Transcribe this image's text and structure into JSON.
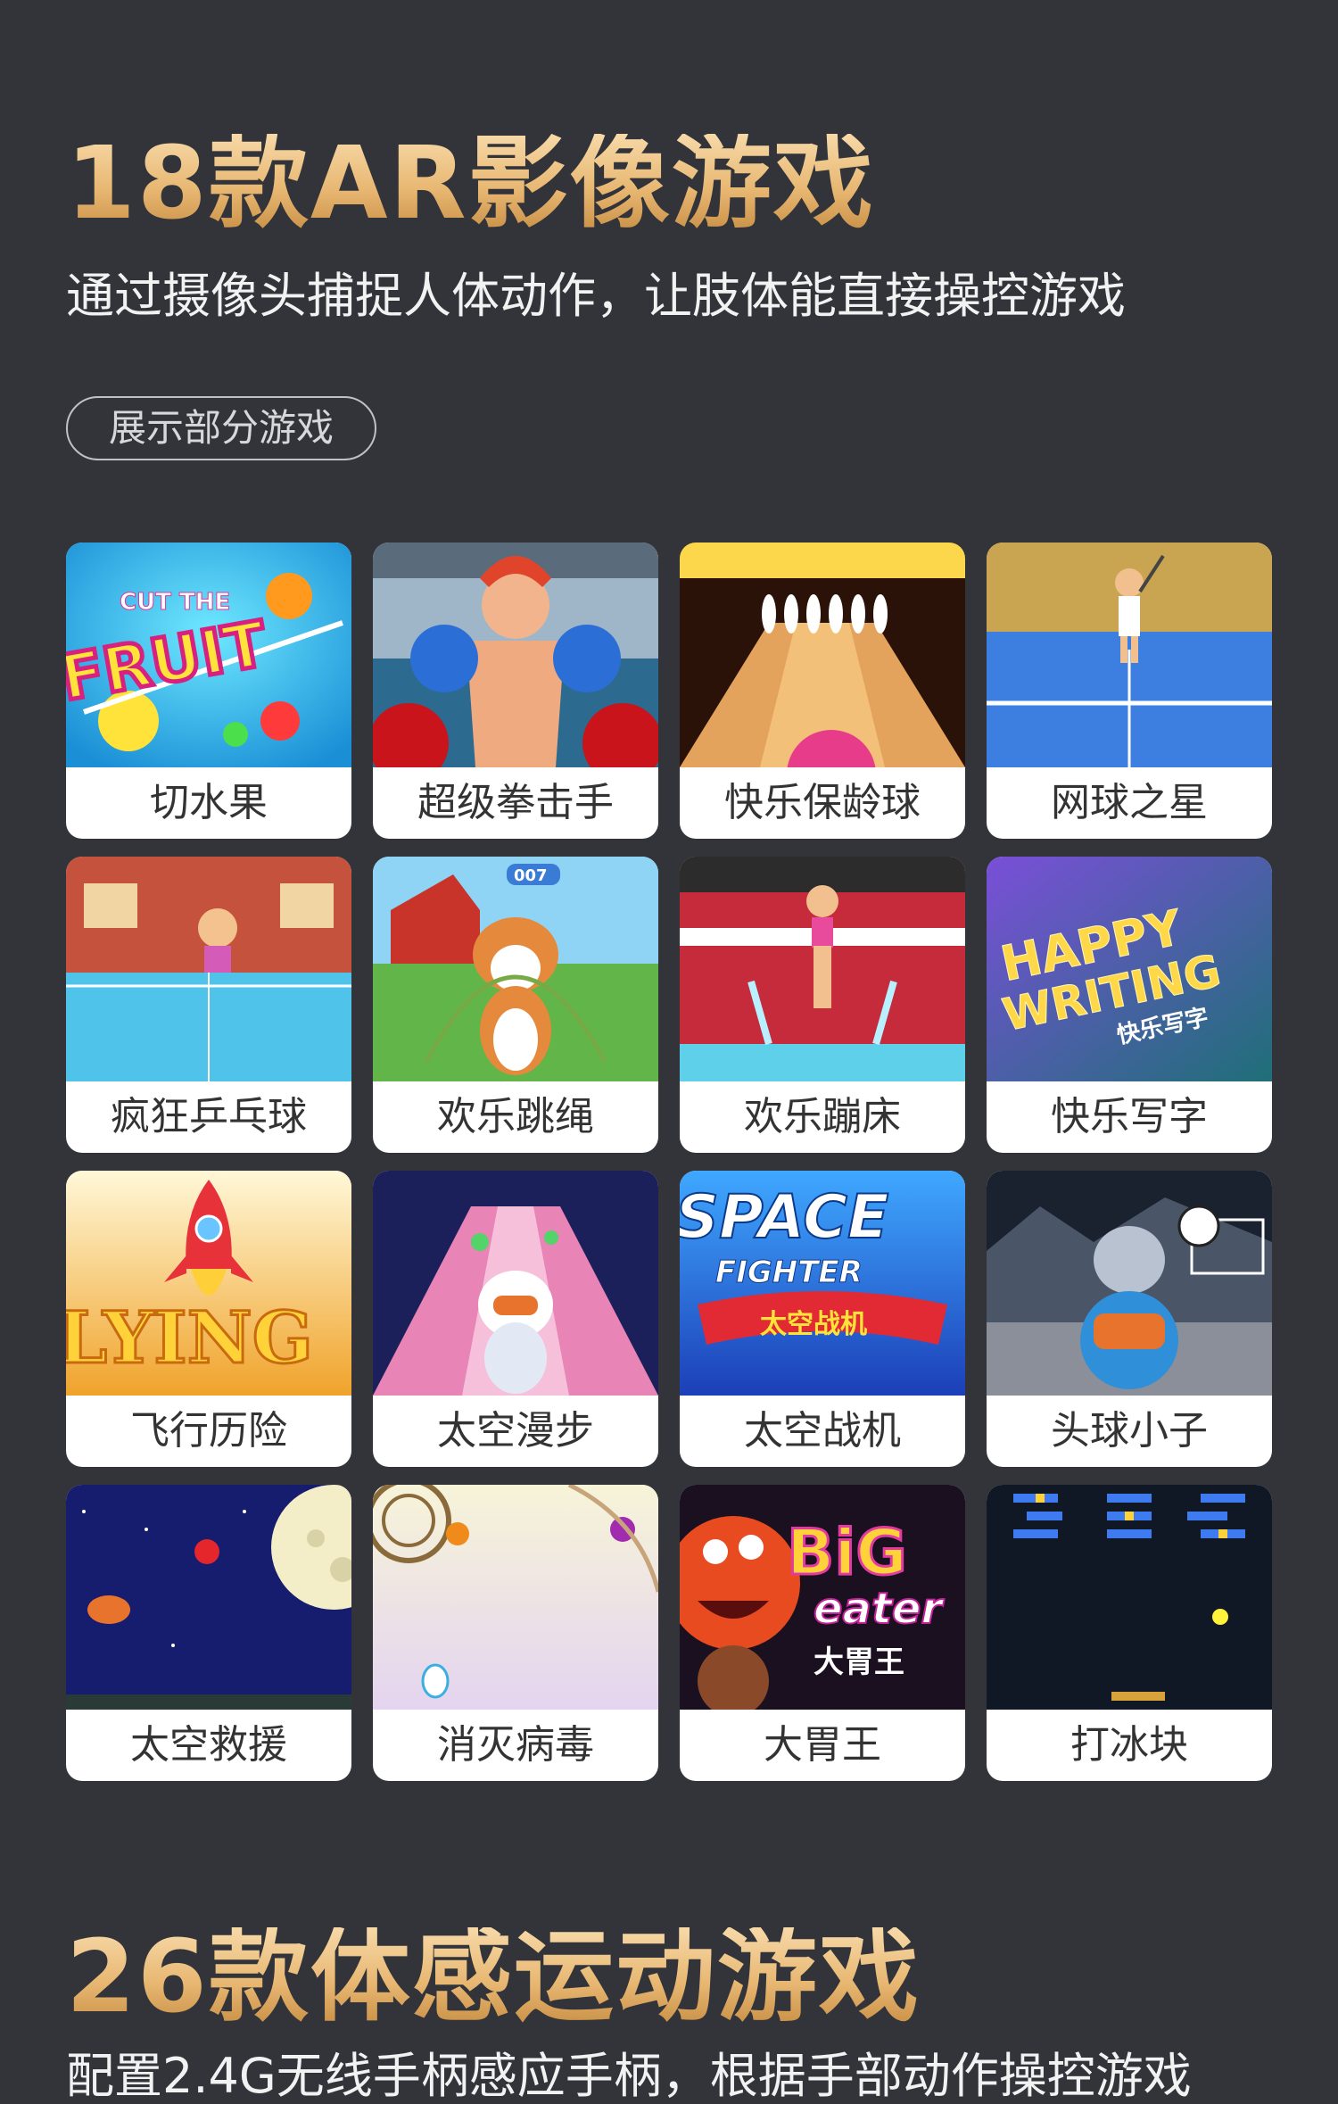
{
  "section1": {
    "title": "18款AR影像游戏",
    "subtitle": "通过摄像头捕捉人体动作，让肢体能直接操控游戏",
    "pill": "展示部分游戏",
    "games": [
      {
        "name": "切水果",
        "icon": "fruit-cut-thumbnail",
        "overlay": "CUT THE FRUIT"
      },
      {
        "name": "超级拳击手",
        "icon": "boxer-thumbnail"
      },
      {
        "name": "快乐保龄球",
        "icon": "bowling-thumbnail"
      },
      {
        "name": "网球之星",
        "icon": "tennis-thumbnail"
      },
      {
        "name": "疯狂乒乓球",
        "icon": "ping-pong-thumbnail"
      },
      {
        "name": "欢乐跳绳",
        "icon": "jump-rope-thumbnail",
        "overlay": "007"
      },
      {
        "name": "欢乐蹦床",
        "icon": "trampoline-thumbnail"
      },
      {
        "name": "快乐写字",
        "icon": "writing-thumbnail",
        "overlay": "HAPPY WRITING",
        "overlay2": "快乐写字"
      },
      {
        "name": "飞行历险",
        "icon": "rocket-thumbnail",
        "overlay": "LYING"
      },
      {
        "name": "太空漫步",
        "icon": "space-walk-thumbnail"
      },
      {
        "name": "太空战机",
        "icon": "space-fighter-thumbnail",
        "overlay": "SPACE",
        "overlay2": "FIGHTER",
        "overlay3": "太空战机"
      },
      {
        "name": "头球小子",
        "icon": "header-soccer-thumbnail"
      },
      {
        "name": "太空救援",
        "icon": "space-rescue-thumbnail"
      },
      {
        "name": "消灭病毒",
        "icon": "virus-thumbnail"
      },
      {
        "name": "大胃王",
        "icon": "big-eater-thumbnail",
        "overlay": "BiG",
        "overlay2": "eater",
        "overlay3": "大胃王"
      },
      {
        "name": "打冰块",
        "icon": "brick-breaker-thumbnail"
      }
    ]
  },
  "section2": {
    "title": "26款体感运动游戏",
    "subtitle": "配置2.4G无线手柄感应手柄，根据手部动作操控游戏"
  },
  "colors": {
    "background": "#32343a",
    "title_gold": "#e8b873",
    "card": "#ffffff",
    "label_text": "#333333"
  }
}
